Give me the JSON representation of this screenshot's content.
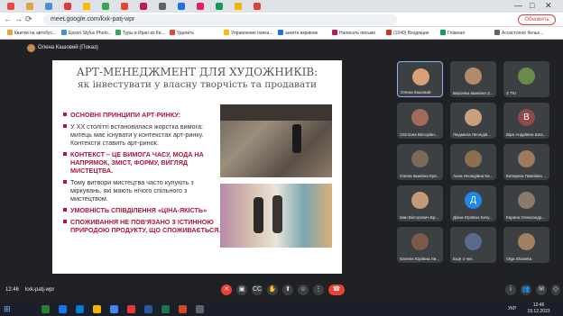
{
  "browser": {
    "url": "meet.google.com/kxk-patj-wpr",
    "update_label": "Обновить",
    "tab_icon_colors": [
      "#e44",
      "#e8a33d",
      "#4a90d9",
      "#e53935",
      "#fbbc04",
      "#34a853",
      "#ea4335",
      "#c2185b",
      "#5f6368",
      "#1a73e8",
      "#e91e63",
      "#0f9d58",
      "#f4b400",
      "#db4437"
    ],
    "bookmarks": [
      "Квитки на автобус...",
      "Epson Stylus Photo...",
      "Туры в Иран из Ки...",
      "Удалить",
      "Управление папка...",
      "анкета вкрівник",
      "Написать письмо",
      "(1040) Входящие",
      "Главная",
      "Ассистолое белье..."
    ]
  },
  "meet": {
    "presenter": "Олена Кашовий (Показ)",
    "meeting_code": "kxk-patj-wpr",
    "time": "12:46",
    "others_count": "Ещё 4 чел."
  },
  "slide": {
    "title": "АРТ-МЕНЕДЖМЕНТ ДЛЯ ХУДОЖНИКІВ:",
    "subtitle": "як інвестувати у власну творчість та продавати",
    "bullets": [
      {
        "text": "ОСНОВНІ ПРИНЦИПИ АРТ-РИНКУ:",
        "style": "red"
      },
      {
        "text": "У XX столітті встановилася жорстка вимога: митець має існувати у контекстах арт-ринку. Контексти ставить арт-ринок.",
        "style": "normal"
      },
      {
        "text": "КОНТЕКСТ – ЦЕ ВИМОГА ЧАСУ, МОДА НА НАПРЯМОК, ЗМІСТ, ФОРМУ, ВИГЛЯД МИСТЕЦТВА.",
        "style": "red"
      },
      {
        "text": "Тому витвори мистецтва часто купують з міркувань, які мають нічого спільного з мистецтвом.",
        "style": "normal"
      },
      {
        "text": "УМОВНІСТЬ СПІВДІЛЕННЯ «ЦІНА-ЯКІСТЬ»",
        "style": "red"
      },
      {
        "text": "СПОЖИВАННЯ НЕ ПОВ'ЯЗАНО З ІСТИННОЮ ПРИРОДОЮ ПРОДУКТУ, ЩО СПОЖИВАЄТЬСЯ.",
        "style": "red"
      }
    ]
  },
  "participants": [
    {
      "name": "Олена Кашовий",
      "color": "#d9a07a",
      "initial": ""
    },
    {
      "name": "Вероніка Іванівна З...",
      "color": "#b58a6a",
      "initial": ""
    },
    {
      "name": "S TIV",
      "color": "#6a8a4a",
      "initial": ""
    },
    {
      "name": "Світлана Вікторівн...",
      "color": "#a06b5a",
      "initial": ""
    },
    {
      "name": "Людмила Леонідів...",
      "color": "#c9a07e",
      "initial": ""
    },
    {
      "name": "Віра Андріївна Шпа...",
      "color": "#8d4b4b",
      "initial": "В"
    },
    {
      "name": "Олена Іванівна Кра...",
      "color": "#7a6a5a",
      "initial": ""
    },
    {
      "name": "Анна Леонідівна Ка...",
      "color": "#8a6f50",
      "initial": ""
    },
    {
      "name": "Катерина Павлівна ...",
      "color": "#a0785a",
      "initial": ""
    },
    {
      "name": "Іван Вікторович Бр...",
      "color": "#c49a78",
      "initial": ""
    },
    {
      "name": "Діана Юріївна Качу...",
      "color": "#1e88e5",
      "initial": "Д"
    },
    {
      "name": "Карина Олександр...",
      "color": "#8a7a6a",
      "initial": ""
    },
    {
      "name": "Євгенія Юріївна Ли...",
      "color": "#7b5a4a",
      "initial": ""
    },
    {
      "name": "Ещё 4 чел.",
      "color": "#5a6b8a",
      "initial": ""
    },
    {
      "name": "Olga Shaveka",
      "color": "#a08060",
      "initial": ""
    }
  ],
  "taskbar": {
    "time": "12:46",
    "date": "19.12.2023",
    "lang": "УКР"
  }
}
